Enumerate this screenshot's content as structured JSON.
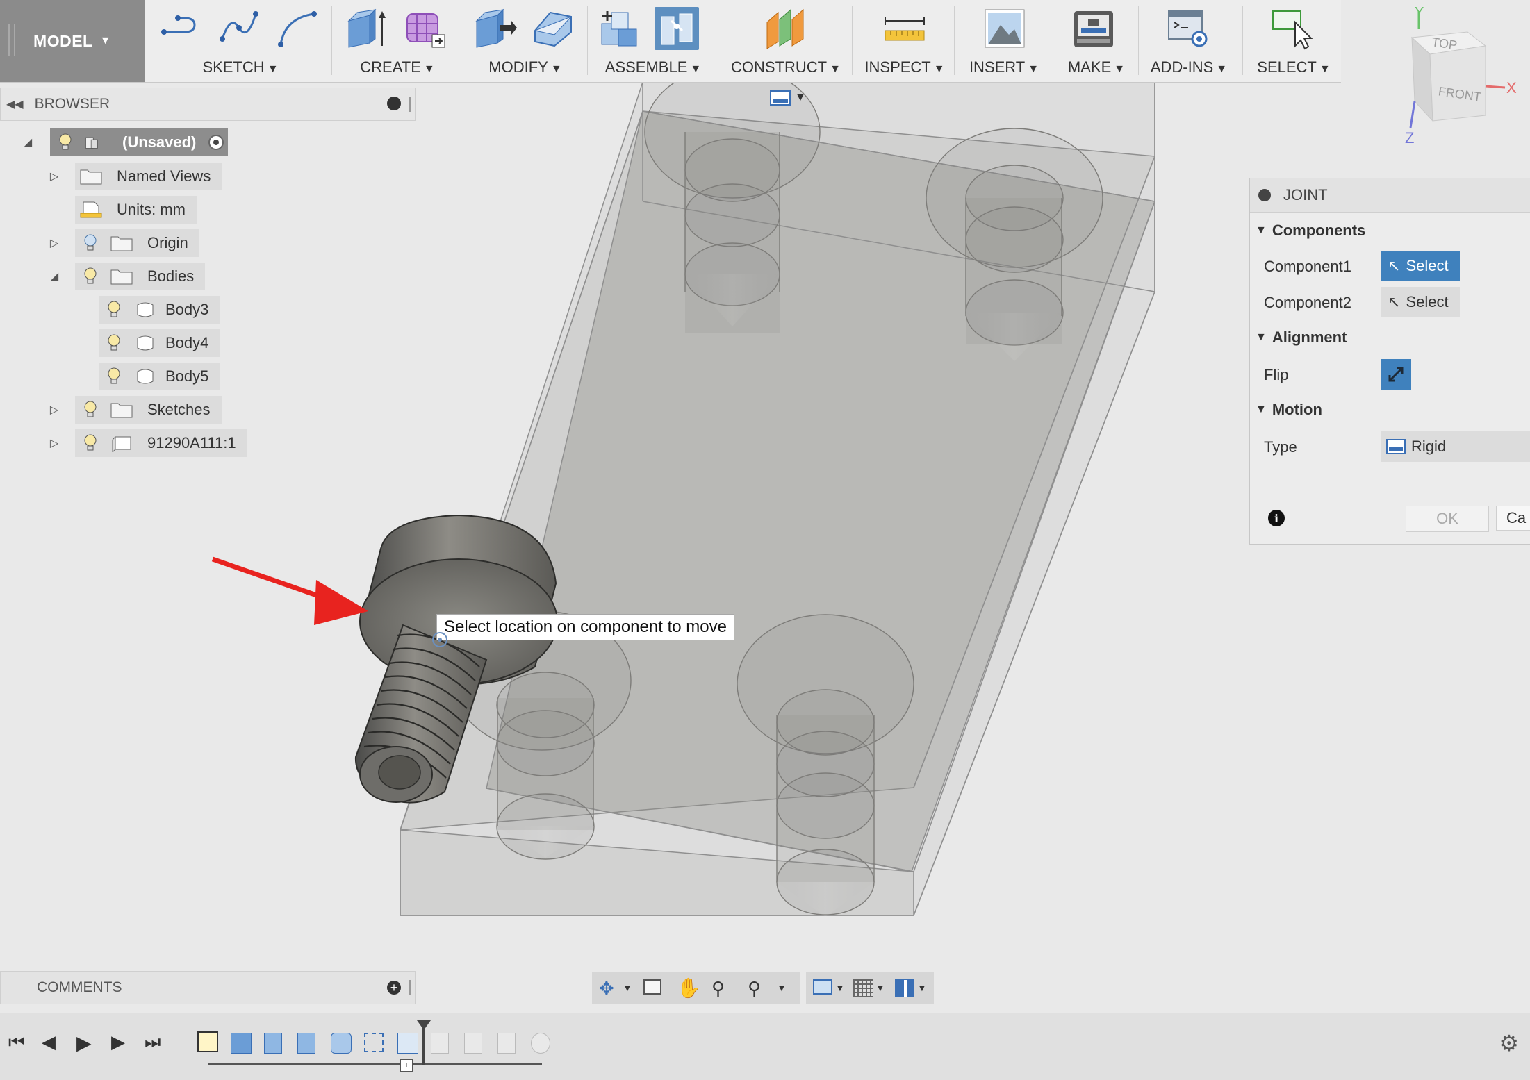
{
  "toolbar": {
    "workspace": "MODEL",
    "groups": [
      {
        "label": "SKETCH"
      },
      {
        "label": "CREATE"
      },
      {
        "label": "MODIFY"
      },
      {
        "label": "ASSEMBLE"
      },
      {
        "label": "CONSTRUCT"
      },
      {
        "label": "INSPECT"
      },
      {
        "label": "INSERT"
      },
      {
        "label": "MAKE"
      },
      {
        "label": "ADD-INS"
      },
      {
        "label": "SELECT"
      }
    ]
  },
  "viewcube": {
    "top": "TOP",
    "front": "FRONT",
    "axis_x": "X",
    "axis_y": "Y",
    "axis_z": "Z"
  },
  "browser": {
    "title": "BROWSER",
    "root": "(Unsaved)",
    "items": [
      {
        "label": "Named Views"
      },
      {
        "label": "Units: mm"
      },
      {
        "label": "Origin"
      },
      {
        "label": "Bodies"
      },
      {
        "label": "Body3"
      },
      {
        "label": "Body4"
      },
      {
        "label": "Body5"
      },
      {
        "label": "Sketches"
      },
      {
        "label": "91290A111:1"
      }
    ]
  },
  "joint": {
    "title": "JOINT",
    "components_header": "Components",
    "component1_label": "Component1",
    "component1_value": "Select",
    "component2_label": "Component2",
    "component2_value": "Select",
    "alignment_header": "Alignment",
    "flip_label": "Flip",
    "motion_header": "Motion",
    "type_label": "Type",
    "type_value": "Rigid",
    "ok_label": "OK",
    "cancel_label": "Ca"
  },
  "tooltip": "Select location on component to move",
  "comments": {
    "title": "COMMENTS"
  },
  "colors": {
    "accent": "#3f81bd",
    "arrow": "#e8231f",
    "workspace_bg": "#8b8b8b"
  }
}
